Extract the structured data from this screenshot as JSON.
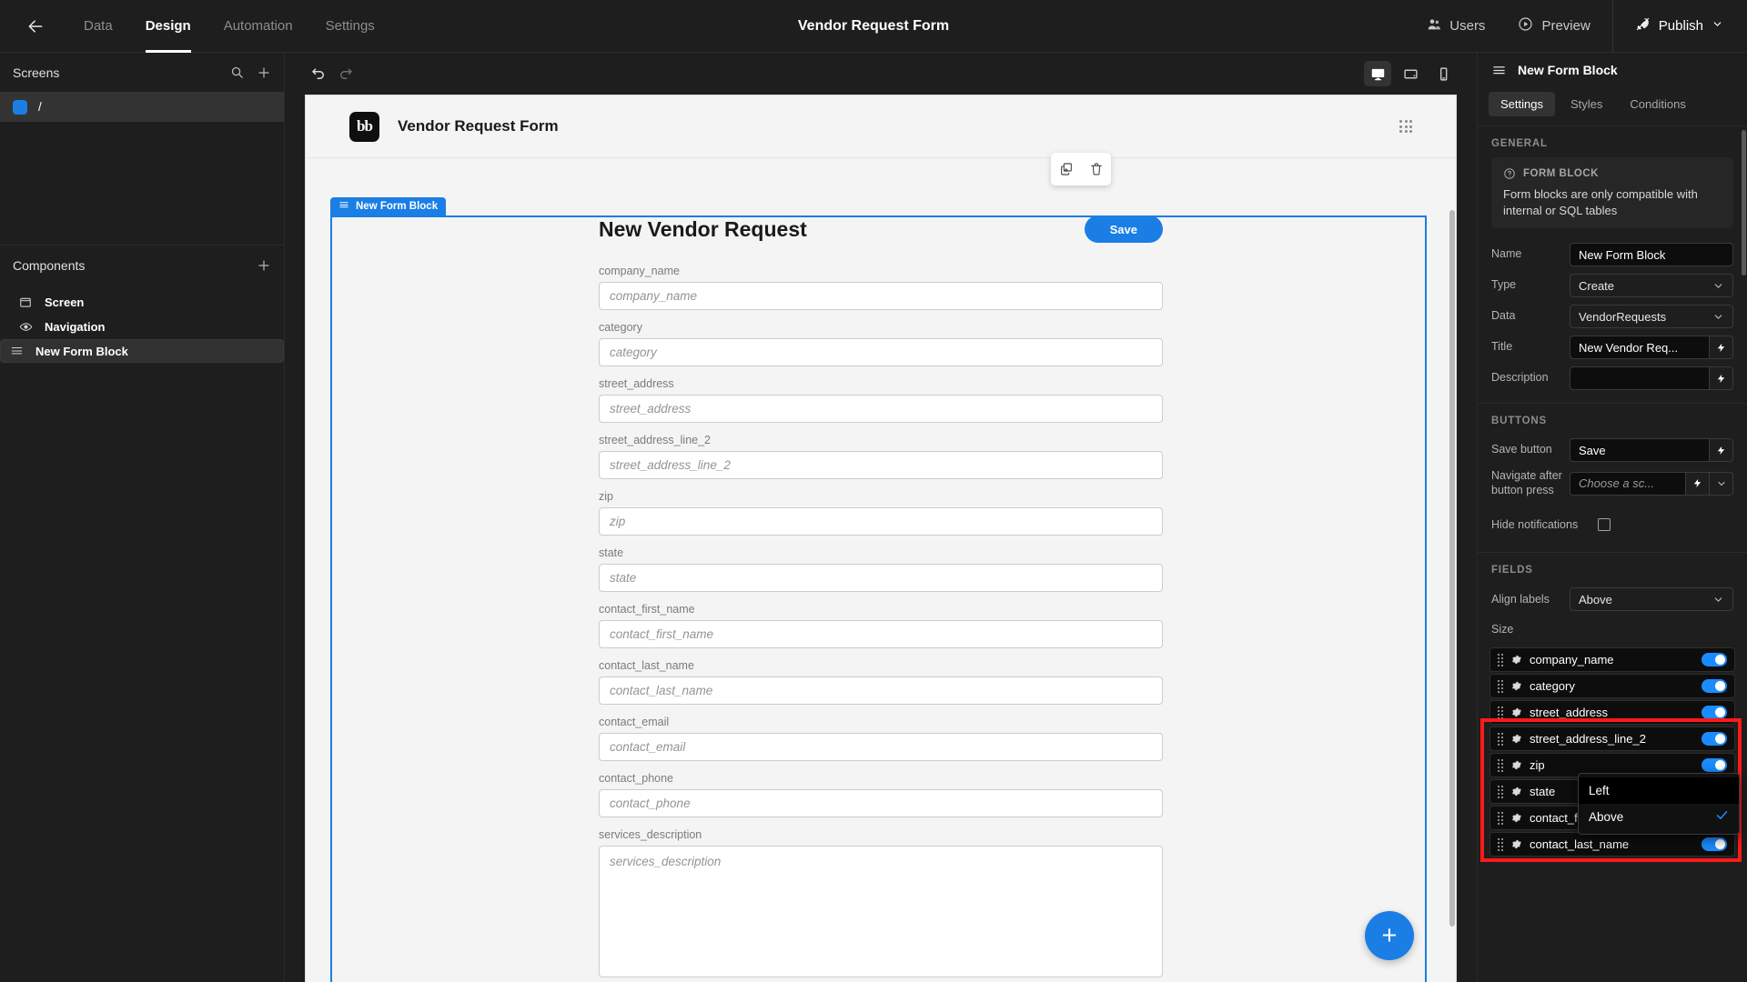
{
  "topbar": {
    "back_icon": "arrow-left-icon",
    "nav": [
      {
        "label": "Data",
        "active": false
      },
      {
        "label": "Design",
        "active": true
      },
      {
        "label": "Automation",
        "active": false
      },
      {
        "label": "Settings",
        "active": false
      }
    ],
    "title": "Vendor Request Form",
    "users_label": "Users",
    "preview_label": "Preview",
    "publish_label": "Publish"
  },
  "left_panel": {
    "screens_title": "Screens",
    "screens": [
      {
        "label": "/",
        "selected": true
      }
    ],
    "components_title": "Components",
    "components": [
      {
        "label": "Screen",
        "icon": "screen-icon",
        "selected": false
      },
      {
        "label": "Navigation",
        "icon": "eye-icon",
        "selected": false
      },
      {
        "label": "New Form Block",
        "icon": "form-block-icon",
        "selected": true
      }
    ]
  },
  "canvas": {
    "undo_icon": "undo-icon",
    "redo_icon": "redo-icon",
    "devices": [
      {
        "name": "desktop",
        "active": true
      },
      {
        "name": "tablet",
        "active": false
      },
      {
        "name": "mobile",
        "active": false
      }
    ],
    "app_logo_text": "bb",
    "app_title": "Vendor Request Form",
    "float_tools": [
      "duplicate-icon",
      "delete-icon"
    ],
    "selection_badge": "New Form Block",
    "form_title": "New Vendor Request",
    "save_label": "Save",
    "fields": [
      {
        "label": "company_name",
        "placeholder": "company_name",
        "type": "text"
      },
      {
        "label": "category",
        "placeholder": "category",
        "type": "text"
      },
      {
        "label": "street_address",
        "placeholder": "street_address",
        "type": "text"
      },
      {
        "label": "street_address_line_2",
        "placeholder": "street_address_line_2",
        "type": "text"
      },
      {
        "label": "zip",
        "placeholder": "zip",
        "type": "text"
      },
      {
        "label": "state",
        "placeholder": "state",
        "type": "text"
      },
      {
        "label": "contact_first_name",
        "placeholder": "contact_first_name",
        "type": "text"
      },
      {
        "label": "contact_last_name",
        "placeholder": "contact_last_name",
        "type": "text"
      },
      {
        "label": "contact_email",
        "placeholder": "contact_email",
        "type": "text"
      },
      {
        "label": "contact_phone",
        "placeholder": "contact_phone",
        "type": "text"
      },
      {
        "label": "services_description",
        "placeholder": "services_description",
        "type": "textarea"
      }
    ],
    "fab_label": "+"
  },
  "right_panel": {
    "header_title": "New Form Block",
    "tabs": [
      {
        "label": "Settings",
        "active": true
      },
      {
        "label": "Styles",
        "active": false
      },
      {
        "label": "Conditions",
        "active": false
      }
    ],
    "general": {
      "section_title": "GENERAL",
      "info_title": "FORM BLOCK",
      "info_text": "Form blocks are only compatible with internal or SQL tables",
      "name_label": "Name",
      "name_value": "New Form Block",
      "type_label": "Type",
      "type_value": "Create",
      "data_label": "Data",
      "data_value": "VendorRequests",
      "title_label": "Title",
      "title_value": "New Vendor Req...",
      "description_label": "Description",
      "description_value": ""
    },
    "buttons": {
      "section_title": "BUTTONS",
      "save_button_label": "Save button",
      "save_button_value": "Save",
      "navigate_label": "Navigate after button press",
      "navigate_placeholder": "Choose a sc...",
      "hide_notifications_label": "Hide notifications",
      "hide_notifications_checked": false
    },
    "fields_section": {
      "section_title": "FIELDS",
      "align_labels_label": "Align labels",
      "align_labels_value": "Above",
      "align_labels_options": [
        {
          "label": "Left",
          "checked": false
        },
        {
          "label": "Above",
          "checked": true
        }
      ],
      "size_label": "Size",
      "field_rows": [
        {
          "name": "company_name",
          "enabled": true
        },
        {
          "name": "category",
          "enabled": true
        },
        {
          "name": "street_address",
          "enabled": true
        },
        {
          "name": "street_address_line_2",
          "enabled": true
        },
        {
          "name": "zip",
          "enabled": true
        },
        {
          "name": "state",
          "enabled": true
        },
        {
          "name": "contact_first_name",
          "enabled": true
        },
        {
          "name": "contact_last_name",
          "enabled": true
        }
      ]
    }
  },
  "colors": {
    "accent": "#1a7ee5",
    "toggle_on": "#1a8cff",
    "annotation": "#ff1a1a",
    "panel_bg": "#1e1e1e",
    "canvas_bg": "#f4f4f4"
  }
}
